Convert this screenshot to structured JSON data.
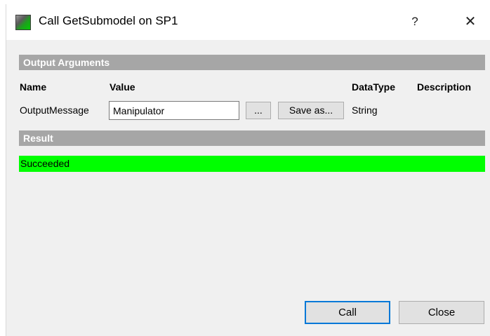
{
  "window": {
    "title": "Call GetSubmodel on SP1",
    "help_label": "?",
    "close_label": "✕"
  },
  "output_section": {
    "header": "Output Arguments",
    "columns": {
      "name": "Name",
      "value": "Value",
      "datatype": "DataType",
      "description": "Description"
    },
    "rows": [
      {
        "name": "OutputMessage",
        "value": "Manipulator",
        "browse_label": "...",
        "save_label": "Save as...",
        "datatype": "String",
        "description": ""
      }
    ]
  },
  "result_section": {
    "header": "Result",
    "status": "Succeeded",
    "status_color": "#00ff00"
  },
  "buttons": {
    "call": "Call",
    "close": "Close"
  },
  "colors": {
    "section_header_bg": "#a6a6a6",
    "focus_border": "#0078d7"
  }
}
